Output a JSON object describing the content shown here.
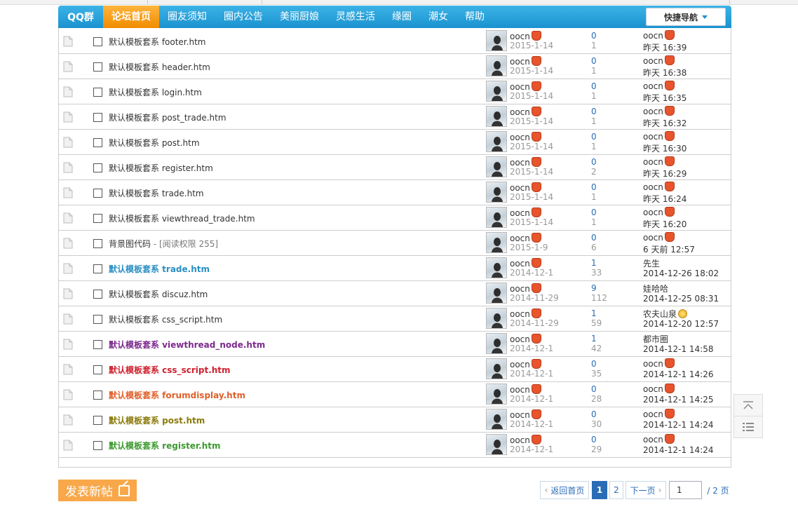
{
  "nav": {
    "brand": "QQ群",
    "items": [
      "论坛首页",
      "圈友须知",
      "圈内公告",
      "美丽厨娘",
      "灵感生活",
      "缘圈",
      "潮女",
      "帮助"
    ],
    "active_index": 0,
    "quick_nav": "快捷导航"
  },
  "threads": [
    {
      "title": "默认模板套系 footer.htm",
      "extra": "",
      "style": "normal",
      "color": "#333333",
      "author": "oocn",
      "date": "2015-1-14",
      "replies": "0",
      "views": "1",
      "last_user": "oocn",
      "last_time": "昨天 16:39",
      "last_badge": "medal-red"
    },
    {
      "title": "默认模板套系 header.htm",
      "extra": "",
      "style": "normal",
      "color": "#333333",
      "author": "oocn",
      "date": "2015-1-14",
      "replies": "0",
      "views": "1",
      "last_user": "oocn",
      "last_time": "昨天 16:38",
      "last_badge": "medal-red"
    },
    {
      "title": "默认模板套系 login.htm",
      "extra": "",
      "style": "normal",
      "color": "#333333",
      "author": "oocn",
      "date": "2015-1-14",
      "replies": "0",
      "views": "1",
      "last_user": "oocn",
      "last_time": "昨天 16:35",
      "last_badge": "medal-red"
    },
    {
      "title": "默认模板套系 post_trade.htm",
      "extra": "",
      "style": "normal",
      "color": "#333333",
      "author": "oocn",
      "date": "2015-1-14",
      "replies": "0",
      "views": "1",
      "last_user": "oocn",
      "last_time": "昨天 16:32",
      "last_badge": "medal-red"
    },
    {
      "title": "默认模板套系 post.htm",
      "extra": "",
      "style": "normal",
      "color": "#333333",
      "author": "oocn",
      "date": "2015-1-14",
      "replies": "0",
      "views": "1",
      "last_user": "oocn",
      "last_time": "昨天 16:30",
      "last_badge": "medal-red"
    },
    {
      "title": "默认模板套系 register.htm",
      "extra": "",
      "style": "normal",
      "color": "#333333",
      "author": "oocn",
      "date": "2015-1-14",
      "replies": "0",
      "views": "2",
      "last_user": "oocn",
      "last_time": "昨天 16:29",
      "last_badge": "medal-red"
    },
    {
      "title": "默认模板套系 trade.htm",
      "extra": "",
      "style": "normal",
      "color": "#333333",
      "author": "oocn",
      "date": "2015-1-14",
      "replies": "0",
      "views": "1",
      "last_user": "oocn",
      "last_time": "昨天 16:24",
      "last_badge": "medal-red"
    },
    {
      "title": "默认模板套系 viewthread_trade.htm",
      "extra": "",
      "style": "normal",
      "color": "#333333",
      "author": "oocn",
      "date": "2015-1-14",
      "replies": "0",
      "views": "1",
      "last_user": "oocn",
      "last_time": "昨天 16:20",
      "last_badge": "medal-red"
    },
    {
      "title": "背景图代码",
      "extra": " - [阅读权限 255]",
      "style": "normal",
      "color": "#333333",
      "author": "oocn",
      "date": "2015-1-9",
      "replies": "0",
      "views": "6",
      "last_user": "oocn",
      "last_time": "6 天前 12:57",
      "last_badge": "medal-red"
    },
    {
      "title": "默认模板套系 trade.htm",
      "extra": "",
      "style": "bold",
      "color": "#2b8fc4",
      "author": "oocn",
      "date": "2014-12-1",
      "replies": "1",
      "views": "33",
      "last_user": "先生",
      "last_time": "2014-12-26 18:02",
      "last_badge": ""
    },
    {
      "title": "默认模板套系 discuz.htm",
      "extra": "",
      "style": "normal",
      "color": "#333333",
      "author": "oocn",
      "date": "2014-11-29",
      "replies": "9",
      "views": "112",
      "last_user": "娃哈哈",
      "last_time": "2014-12-25 08:31",
      "last_badge": ""
    },
    {
      "title": "默认模板套系 css_script.htm",
      "extra": "",
      "style": "normal",
      "color": "#333333",
      "author": "oocn",
      "date": "2014-11-29",
      "replies": "1",
      "views": "59",
      "last_user": "农夫山泉",
      "last_time": "2014-12-20 12:57",
      "last_badge": "medal-gold"
    },
    {
      "title": "默认模板套系 viewthread_node.htm",
      "extra": "",
      "style": "bold",
      "color": "#7b2a8c",
      "author": "oocn",
      "date": "2014-12-1",
      "replies": "1",
      "views": "42",
      "last_user": "都市圈",
      "last_time": "2014-12-1 14:58",
      "last_badge": ""
    },
    {
      "title": "默认模板套系 css_script.htm",
      "extra": "",
      "style": "bold",
      "color": "#d0202e",
      "author": "oocn",
      "date": "2014-12-1",
      "replies": "0",
      "views": "35",
      "last_user": "oocn",
      "last_time": "2014-12-1 14:26",
      "last_badge": "medal-red"
    },
    {
      "title": "默认模板套系 forumdisplay.htm",
      "extra": "",
      "style": "bold",
      "color": "#e0602a",
      "author": "oocn",
      "date": "2014-12-1",
      "replies": "0",
      "views": "28",
      "last_user": "oocn",
      "last_time": "2014-12-1 14:25",
      "last_badge": "medal-red"
    },
    {
      "title": "默认模板套系 post.htm",
      "extra": "",
      "style": "bold",
      "color": "#8b7a0a",
      "author": "oocn",
      "date": "2014-12-1",
      "replies": "0",
      "views": "30",
      "last_user": "oocn",
      "last_time": "2014-12-1 14:24",
      "last_badge": "medal-red"
    },
    {
      "title": "默认模板套系 register.htm",
      "extra": "",
      "style": "bold",
      "color": "#3c9a2e",
      "author": "oocn",
      "date": "2014-12-1",
      "replies": "0",
      "views": "29",
      "last_user": "oocn",
      "last_time": "2014-12-1 14:24",
      "last_badge": "medal-red"
    }
  ],
  "author_badge": "medal-red",
  "actions": {
    "new_post": "发表新帖"
  },
  "pagination": {
    "back": "返回首页",
    "current": "1",
    "page2": "2",
    "next": "下一页",
    "input_value": "1",
    "total": "/ 2 页"
  },
  "side": {
    "top_icon": "back-to-top-icon",
    "list_icon": "list-icon"
  }
}
